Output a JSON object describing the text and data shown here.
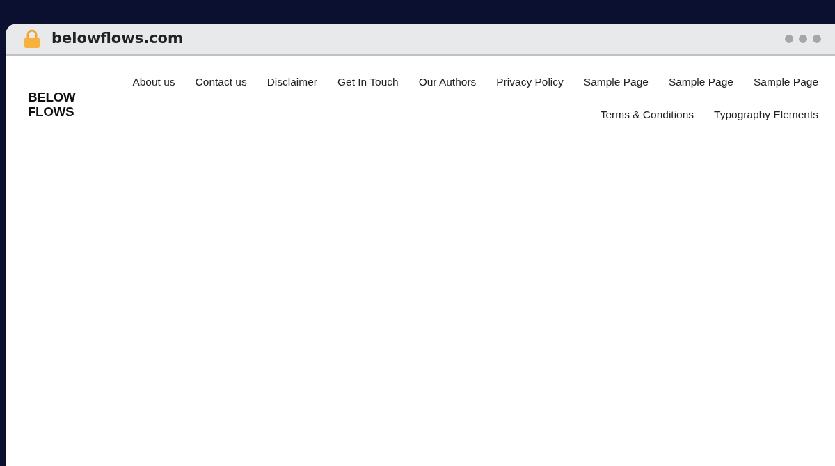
{
  "browser": {
    "url": "belowflows.com"
  },
  "site": {
    "logo": "BELOW FLOWS",
    "nav": [
      "About us",
      "Contact us",
      "Disclaimer",
      "Get In Touch",
      "Our Authors",
      "Privacy Policy",
      "Sample Page",
      "Sample Page",
      "Sample Page",
      "Terms & Conditions",
      "Typography Elements"
    ]
  }
}
